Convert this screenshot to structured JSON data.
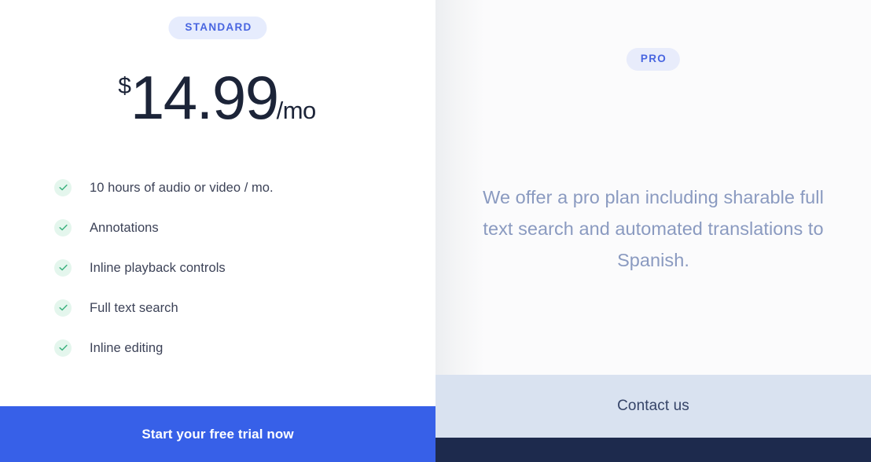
{
  "colors": {
    "accent_blue": "#3760e8",
    "badge_bg": "#e6ecfd",
    "badge_text": "#4865e0",
    "price_text": "#1c2438",
    "feature_text": "#3c4257",
    "check_circle_bg": "#e4f6ed",
    "check_mark": "#3cb27f",
    "pro_panel_bg": "#fbfbfc",
    "pro_description_text": "#8a9ac0",
    "contact_bar_bg": "#d9e2f0",
    "contact_bar_text": "#354468",
    "footer_band": "#1d2a4d"
  },
  "standard_plan": {
    "badge_label": "STANDARD",
    "price": {
      "currency_symbol": "$",
      "amount": "14.99",
      "period": "/mo"
    },
    "features": [
      {
        "label": "10 hours of audio or video / mo.",
        "icon": "check-icon"
      },
      {
        "label": "Annotations",
        "icon": "check-icon"
      },
      {
        "label": "Inline playback controls",
        "icon": "check-icon"
      },
      {
        "label": "Full text search",
        "icon": "check-icon"
      },
      {
        "label": "Inline editing",
        "icon": "check-icon"
      }
    ],
    "cta_label": "Start your free trial now"
  },
  "pro_plan": {
    "badge_label": "PRO",
    "description": "We offer a pro plan including sharable full text search and automated translations to Spanish.",
    "contact_label": "Contact us"
  }
}
